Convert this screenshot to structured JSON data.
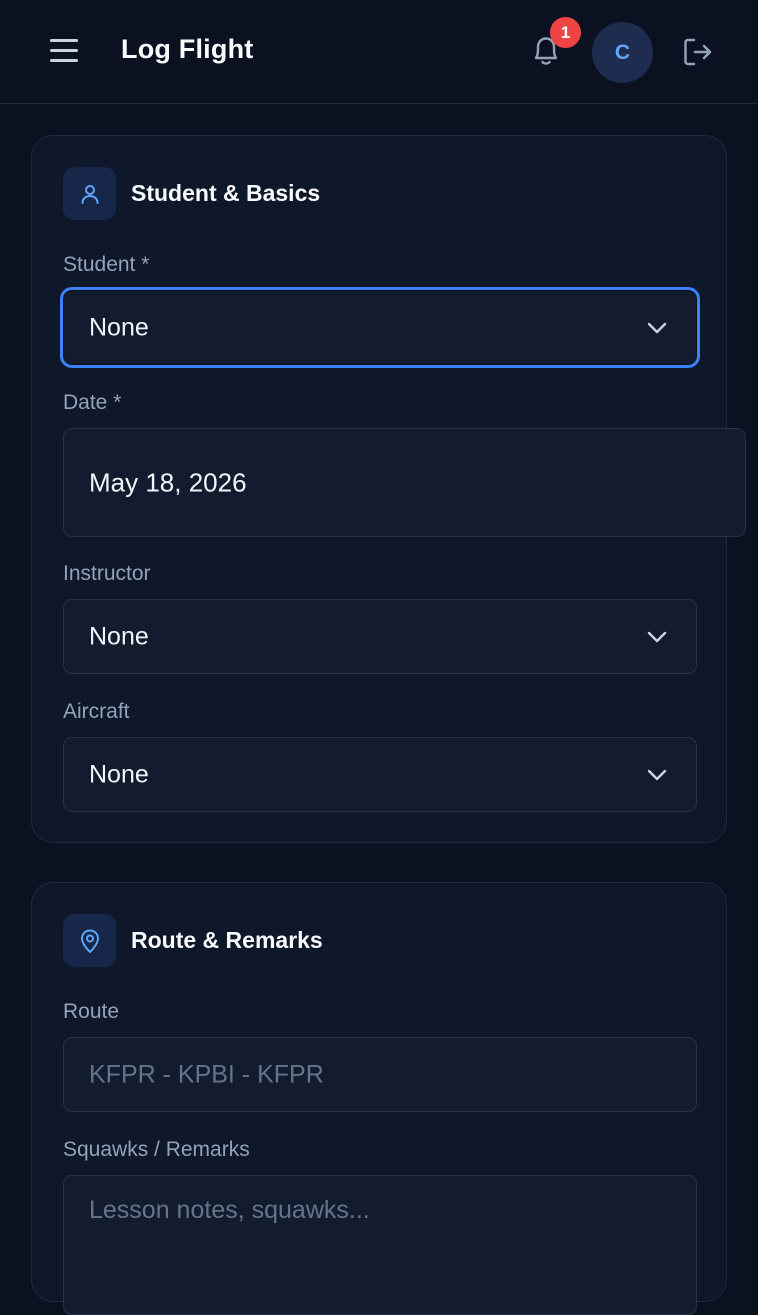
{
  "header": {
    "title": "Log Flight",
    "notification_count": "1",
    "avatar_initial": "C"
  },
  "cards": {
    "basics": {
      "title": "Student & Basics",
      "icon": "user-icon",
      "student": {
        "label": "Student *",
        "value": "None"
      },
      "date": {
        "label": "Date *",
        "value": "May 18, 2026"
      },
      "instructor": {
        "label": "Instructor",
        "value": "None"
      },
      "aircraft": {
        "label": "Aircraft",
        "value": "None"
      }
    },
    "route": {
      "title": "Route & Remarks",
      "icon": "map-pin-icon",
      "route": {
        "label": "Route",
        "placeholder": "KFPR - KPBI - KFPR"
      },
      "remarks": {
        "label": "Squawks / Remarks",
        "placeholder": "Lesson notes, squawks..."
      }
    }
  },
  "colors": {
    "background": "#0b1120",
    "card": "#0f172a",
    "accent": "#3b82f6",
    "badge": "#ef4444"
  }
}
